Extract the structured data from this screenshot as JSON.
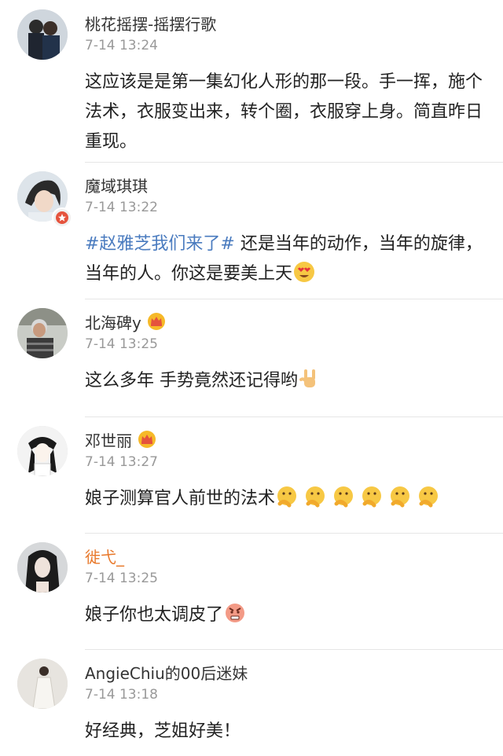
{
  "comments": [
    {
      "name": "桃花摇摆-摇摆行歌",
      "time": "7-14 13:24",
      "text": "这应该是是第一集幻化人形的那一段。手一挥，施个法术，衣服变出来，转个圈，衣服穿上身。简直昨日重现。"
    },
    {
      "name": "魔域琪琪",
      "time": "7-14 13:22",
      "topic": "#赵雅芝我们来了#",
      "text": " 还是当年的动作，当年的旋律，当年的人。你这是要美上天",
      "emoji": "heart-eyes-emoji"
    },
    {
      "name": "北海碑y",
      "time": "7-14 13:25",
      "text": "这么多年 手势竟然还记得哟",
      "emoji": "rock-hand-emoji"
    },
    {
      "name": "邓世丽",
      "time": "7-14 13:27",
      "text": "娘子测算官人前世的法术",
      "emoji": "thinking-emoji"
    },
    {
      "name": "徙弋_",
      "time": "7-14 13:25",
      "text": "娘子你也太调皮了",
      "emoji": "angry-emoji"
    },
    {
      "name": "AngieChiu的00后迷妹",
      "time": "7-14 13:18",
      "text": "好经典，芝姐好美！"
    }
  ],
  "colors": {
    "name": "#333333",
    "name_highlight": "#e8782a",
    "time": "#999999",
    "topic": "#4a7bbf",
    "divider": "#e6e6e6"
  }
}
